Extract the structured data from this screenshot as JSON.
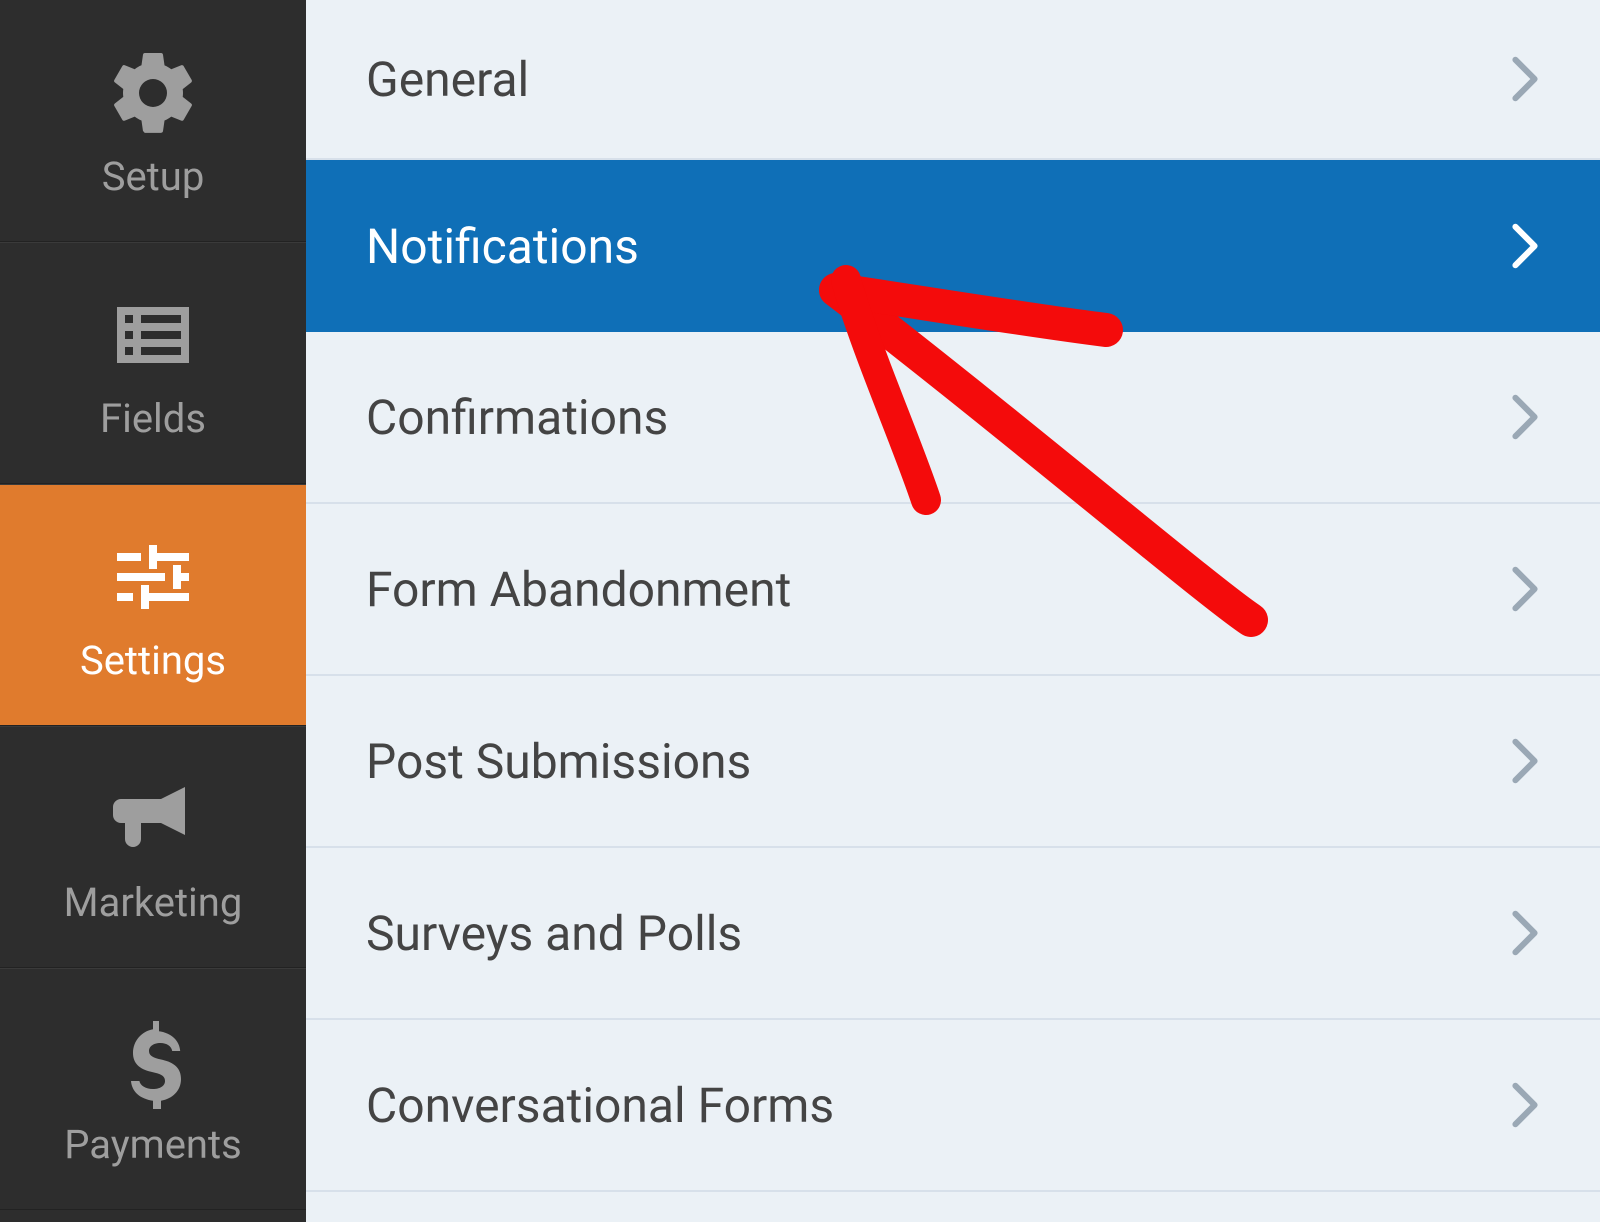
{
  "sidebar": {
    "items": [
      {
        "id": "setup",
        "label": "Setup",
        "active": false
      },
      {
        "id": "fields",
        "label": "Fields",
        "active": false
      },
      {
        "id": "settings",
        "label": "Settings",
        "active": true
      },
      {
        "id": "marketing",
        "label": "Marketing",
        "active": false
      },
      {
        "id": "payments",
        "label": "Payments",
        "active": false
      }
    ]
  },
  "settings": {
    "items": [
      {
        "id": "general",
        "label": "General",
        "selected": false
      },
      {
        "id": "notifications",
        "label": "Notifications",
        "selected": true
      },
      {
        "id": "confirmations",
        "label": "Confirmations",
        "selected": false
      },
      {
        "id": "form-abandonment",
        "label": "Form Abandonment",
        "selected": false
      },
      {
        "id": "post-submissions",
        "label": "Post Submissions",
        "selected": false
      },
      {
        "id": "surveys-polls",
        "label": "Surveys and Polls",
        "selected": false
      },
      {
        "id": "conversational-forms",
        "label": "Conversational Forms",
        "selected": false
      }
    ]
  },
  "annotation": {
    "type": "hand-drawn-arrow",
    "color": "#f40b0b",
    "points_to": "notifications"
  },
  "colors": {
    "sidebar_bg": "#2d2d2d",
    "sidebar_active_bg": "#e07b2d",
    "sidebar_icon": "#9e9e9e",
    "main_bg": "#ebf1f6",
    "item_selected_bg": "#0f6fb7",
    "divider": "#d7e0ea",
    "text": "#444444",
    "chevron": "#9aa8b5",
    "annotation": "#f40b0b"
  }
}
